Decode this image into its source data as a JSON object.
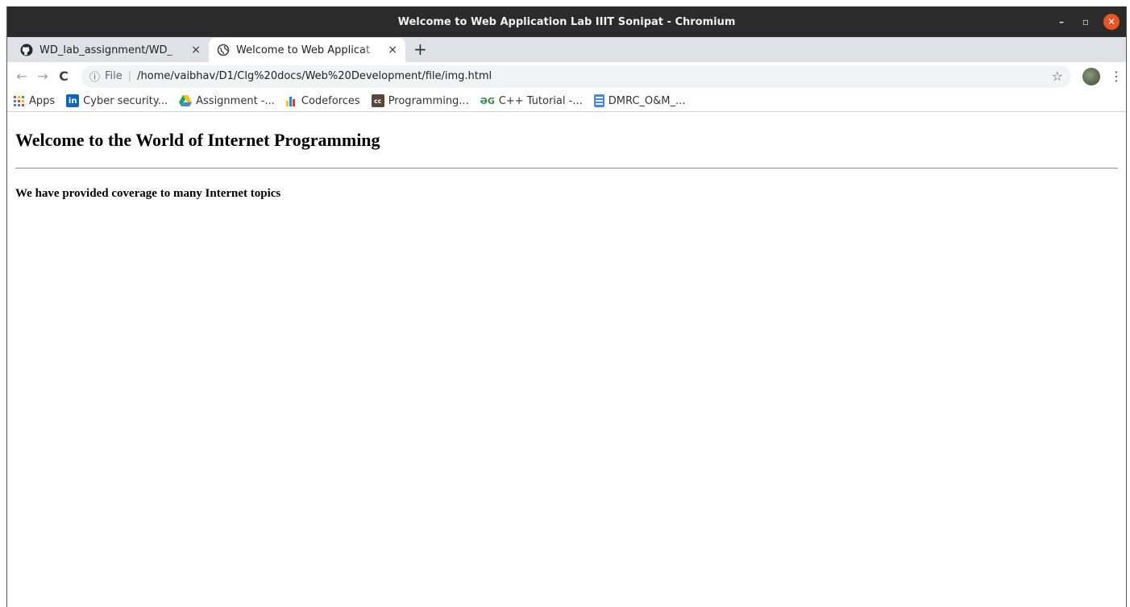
{
  "window": {
    "title": "Welcome to Web Application Lab IIIT Sonipat - Chromium",
    "minimize_icon": "minimize-icon",
    "maximize_icon": "maximize-icon",
    "close_icon": "close-icon",
    "close_color": "#e95420"
  },
  "tabs": [
    {
      "title": "WD_lab_assignment/WD_",
      "icon": "github-icon",
      "active": false
    },
    {
      "title": "Welcome to Web Applicat",
      "icon": "globe-icon",
      "active": true
    }
  ],
  "tab_close_glyph": "×",
  "new_tab_glyph": "+",
  "toolbar": {
    "back_glyph": "←",
    "forward_glyph": "→",
    "reload_glyph": "C",
    "info_glyph": "ⓘ",
    "scheme_label": "File",
    "separator": "|",
    "url": "/home/vaibhav/D1/Clg%20docs/Web%20Development/file/img.html",
    "star_glyph": "☆",
    "menu_glyph": "⋮"
  },
  "bookmarks": [
    {
      "label": "Apps",
      "icon": "apps-icon"
    },
    {
      "label": "Cyber security...",
      "icon": "linkedin-icon",
      "icon_text": "in"
    },
    {
      "label": "Assignment -...",
      "icon": "google-drive-icon"
    },
    {
      "label": "Codeforces",
      "icon": "codeforces-icon"
    },
    {
      "label": "Programming...",
      "icon": "codechef-icon",
      "icon_text": "cc"
    },
    {
      "label": "C++ Tutorial -...",
      "icon": "geeksforgeeks-icon",
      "icon_text": "ƏG"
    },
    {
      "label": "DMRC_O&M_...",
      "icon": "google-docs-icon"
    }
  ],
  "page": {
    "heading": "Welcome to the World of Internet Programming",
    "subheading": "We have provided coverage to many Internet topics"
  },
  "colors": {
    "titlebar": "#2b2b2b",
    "tabstrip": "#dee1e6",
    "omnibox": "#f1f3f4",
    "linkedin": "#0a66c2",
    "docs_blue": "#4285f4"
  }
}
